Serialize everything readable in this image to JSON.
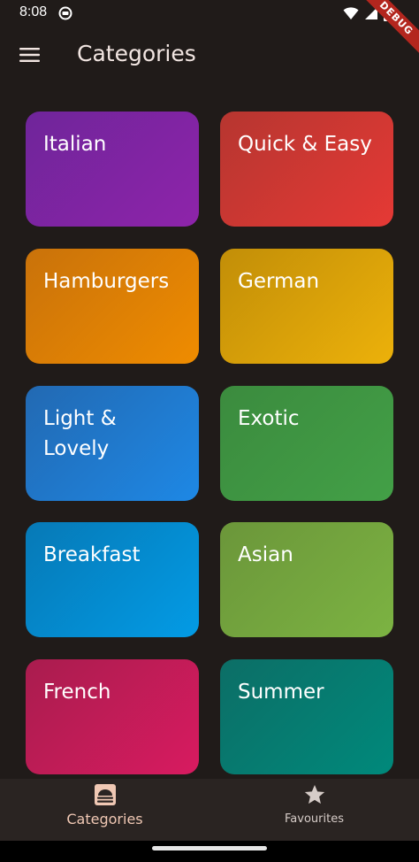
{
  "status_bar": {
    "time": "8:08",
    "debug_label": "DEBUG"
  },
  "app_bar": {
    "title": "Categories",
    "menu_icon": "menu-icon"
  },
  "categories": [
    {
      "label": "Italian",
      "color_from": "#6f259a",
      "color_to": "#8e24aa"
    },
    {
      "label": "Quick & Easy",
      "color_from": "#b63630",
      "color_to": "#e53935"
    },
    {
      "label": "Hamburgers",
      "color_from": "#c9720a",
      "color_to": "#ef8c00"
    },
    {
      "label": "German",
      "color_from": "#c28e08",
      "color_to": "#ecb10a"
    },
    {
      "label": "Light & Lovely",
      "color_from": "#2269b2",
      "color_to": "#1e88e5"
    },
    {
      "label": "Exotic",
      "color_from": "#3b8b3e",
      "color_to": "#43a047"
    },
    {
      "label": "Breakfast",
      "color_from": "#0679b6",
      "color_to": "#039be5"
    },
    {
      "label": "Asian",
      "color_from": "#6b963a",
      "color_to": "#7cb342"
    },
    {
      "label": "French",
      "color_from": "#a91c4e",
      "color_to": "#d81b60"
    },
    {
      "label": "Summer",
      "color_from": "#0c6e66",
      "color_to": "#00897b"
    }
  ],
  "bottom_nav": {
    "items": [
      {
        "label": "Categories",
        "icon": "dish-icon",
        "selected": true
      },
      {
        "label": "Favourites",
        "icon": "star-icon",
        "selected": false
      }
    ]
  }
}
